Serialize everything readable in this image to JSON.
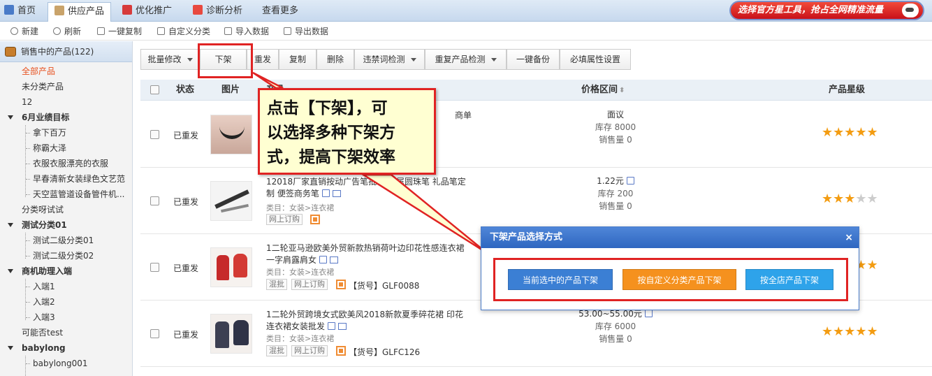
{
  "nav": {
    "tabs": [
      {
        "label": "首页",
        "icon": "home-icon"
      },
      {
        "label": "供应产品",
        "icon": "store-icon"
      },
      {
        "label": "优化推广",
        "icon": "megaphone-icon"
      },
      {
        "label": "诊断分析",
        "icon": "medical-kit-icon"
      },
      {
        "label": "查看更多",
        "icon": ""
      }
    ],
    "active_tab": "供应产品",
    "promo_text": "选择官方星工具，抢占全网精准流量"
  },
  "toolbar": {
    "new": "新建",
    "refresh": "刷新",
    "copy_one": "一键复制",
    "custom_category": "自定义分类",
    "import": "导入数据",
    "export": "导出数据"
  },
  "sidebar": {
    "header": "销售中的产品(122)",
    "items": [
      {
        "label": "全部产品",
        "level": 0,
        "selected": true
      },
      {
        "label": "未分类产品",
        "level": 0
      },
      {
        "label": "12",
        "level": 0
      },
      {
        "label": "6月业绩目标",
        "level": 0,
        "group": true
      },
      {
        "label": "拿下百万",
        "level": 1
      },
      {
        "label": "称霸大泽",
        "level": 1
      },
      {
        "label": "衣服衣服漂亮的衣服",
        "level": 1
      },
      {
        "label": "早春清新女装绿色文艺范",
        "level": 1
      },
      {
        "label": "天空蓝管道设备管件机...",
        "level": 1
      },
      {
        "label": "分类呀试试",
        "level": 0
      },
      {
        "label": "测试分类01",
        "level": 0,
        "group": true
      },
      {
        "label": "测试二级分类01",
        "level": 1
      },
      {
        "label": "测试二级分类02",
        "level": 1
      },
      {
        "label": "商机助理入端",
        "level": 0,
        "group": true
      },
      {
        "label": "入端1",
        "level": 1
      },
      {
        "label": "入端2",
        "level": 1
      },
      {
        "label": "入端3",
        "level": 1
      },
      {
        "label": "可能否test",
        "level": 0
      },
      {
        "label": "babylong",
        "level": 0,
        "group": true
      },
      {
        "label": "babylong001",
        "level": 1
      }
    ]
  },
  "actions": {
    "batch_modify": "批量修改",
    "take_down": "下架",
    "repost": "重发",
    "copy": "复制",
    "delete": "删除",
    "banned_words": "违禁词检测",
    "duplicate_check": "重复产品检测",
    "backup": "一键备份",
    "required_attrs": "必填属性设置"
  },
  "table": {
    "headers": {
      "status": "状态",
      "image": "图片",
      "product": "产品",
      "price": "价格区间",
      "rating": "产品星级"
    },
    "rows": [
      {
        "status": "已重发",
        "title_tail": "商单",
        "category": "",
        "price": "面议",
        "stock": "库存 8000",
        "sales": "销售量 0",
        "stars": 5,
        "tags": [],
        "sku": ""
      },
      {
        "status": "已重发",
        "title": "12018厂家直销按动广告笔批发 金属圆珠笔 礼品笔定制 便签商务笔",
        "category": "类目：女装>连衣裙",
        "price": "1.22元",
        "stock": "库存 200",
        "sales": "销售量 0",
        "stars": 3,
        "tags": [
          "网上订购"
        ],
        "sku": ""
      },
      {
        "status": "已重发",
        "title": "1二轮亚马逊欧美外贸新款热销荷叶边印花性感连衣裙一字肩露肩女",
        "category": "类目：女装>连衣裙",
        "price": "",
        "stock": "",
        "sales": "",
        "stars": 5,
        "tags": [
          "混批",
          "网上订购"
        ],
        "sku": "【货号】GLF0088"
      },
      {
        "status": "已重发",
        "title": "1二轮外贸跨境女式欧美风2018新款夏季碎花裙 印花连衣裙女装批发",
        "category": "类目：女装>连衣裙",
        "price": "53.00~55.00元",
        "stock": "库存 6000",
        "sales": "销售量 0",
        "stars": 5,
        "tags": [
          "混批",
          "网上订购"
        ],
        "sku": "【货号】GLFC126"
      }
    ]
  },
  "callout": {
    "line1": "点击【下架】，可",
    "line2": "以选择多种下架方",
    "line3": "式，提高下架效率"
  },
  "dialog": {
    "title": "下架产品选择方式",
    "close": "×",
    "btn_selected": "当前选中的产品下架",
    "btn_by_category": "按自定义分类产品下架",
    "btn_all": "按全店产品下架"
  },
  "colors": {
    "accent_blue": "#3b7fd4",
    "orange": "#f5911e",
    "cyan": "#2ea3ea",
    "highlight_red": "#e02323",
    "star": "#f39c12"
  }
}
